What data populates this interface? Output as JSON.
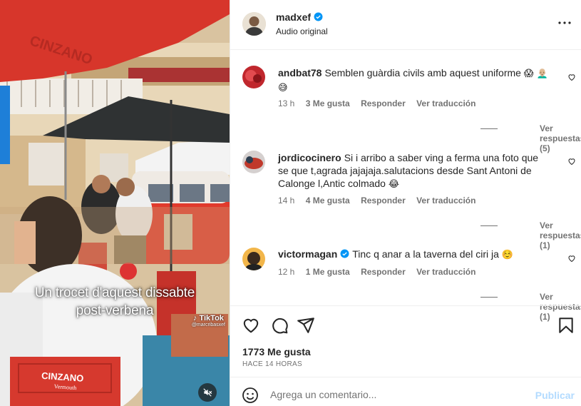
{
  "media": {
    "caption_line1": "Un trocet d'aquest dissabte",
    "caption_line2": "post-verbena",
    "watermark": "TikTok",
    "watermark_handle": "@marcribasxef",
    "awning_brand": "CINZANO",
    "chair_brand": "CINZANO",
    "chair_sub": "Vermouth"
  },
  "header": {
    "username": "madxef",
    "subtitle": "Audio original",
    "verified_color": "#0095f6"
  },
  "comments": [
    {
      "username": "andbat78",
      "text": "Semblen guàrdia civils amb aquest uniforme",
      "emoji": "😱 👨🏼‍🦲 😅",
      "time": "13 h",
      "likes": "3 Me gusta",
      "reply": "Responder",
      "translate": "Ver traducción",
      "view_replies": "Ver respuestas (5)",
      "verified": false
    },
    {
      "username": "jordicocinero",
      "text": "Si i arribo a saber ving a ferma una foto que se que t,agrada jajajaja.salutacions desde Sant Antoni de Calonge l,Antic colmado",
      "emoji": "😂",
      "time": "14 h",
      "likes": "4 Me gusta",
      "reply": "Responder",
      "translate": "Ver traducción",
      "view_replies": "Ver respuestas (1)",
      "verified": false
    },
    {
      "username": "victormagan",
      "text": "Tinc q anar a la taverna del ciri ja",
      "emoji": "☺️",
      "time": "12 h",
      "likes": "1 Me gusta",
      "reply": "Responder",
      "translate": "Ver traducción",
      "view_replies": "Ver respuestas (1)",
      "verified": true
    }
  ],
  "footer": {
    "likes": "1773 Me gusta",
    "time": "HACE 14 HORAS",
    "comment_placeholder": "Agrega un comentario...",
    "post_label": "Publicar"
  },
  "icons": {
    "like": "heart-icon",
    "comment": "comment-icon",
    "share": "share-icon",
    "save": "bookmark-icon",
    "emoji": "emoji-icon",
    "more": "more-options-icon",
    "mute": "muted-speaker-icon"
  },
  "colors": {
    "accent": "#0095f6",
    "post_button_disabled": "#b3dbff",
    "secondary_text": "#737373",
    "divider": "#efefef"
  }
}
